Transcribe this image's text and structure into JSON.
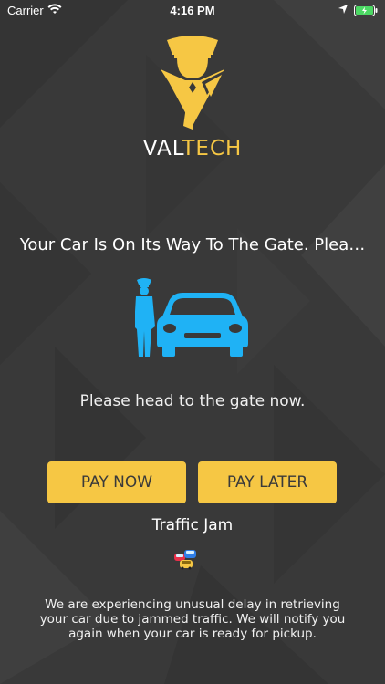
{
  "status_bar": {
    "carrier": "Carrier",
    "time": "4:16 PM"
  },
  "brand": {
    "name_part1": "VAL",
    "name_part2": "TECH",
    "accent_color": "#f6c744",
    "logo_icon": "valet-logo-icon"
  },
  "main": {
    "headline": "Your Car Is On Its Way To The Gate.  Plea…",
    "illustration_icon": "valet-with-car-icon",
    "illustration_color": "#1fb2f5",
    "instruction": "Please head to the gate now."
  },
  "actions": {
    "pay_now_label": "PAY NOW",
    "pay_later_label": "PAY LATER"
  },
  "traffic": {
    "title": "Traffic Jam",
    "icon": "traffic-jam-icon",
    "message": "We are experiencing unusual delay in retrieving your car due to jammed traffic. We will notify you again when your car is ready for pickup."
  }
}
